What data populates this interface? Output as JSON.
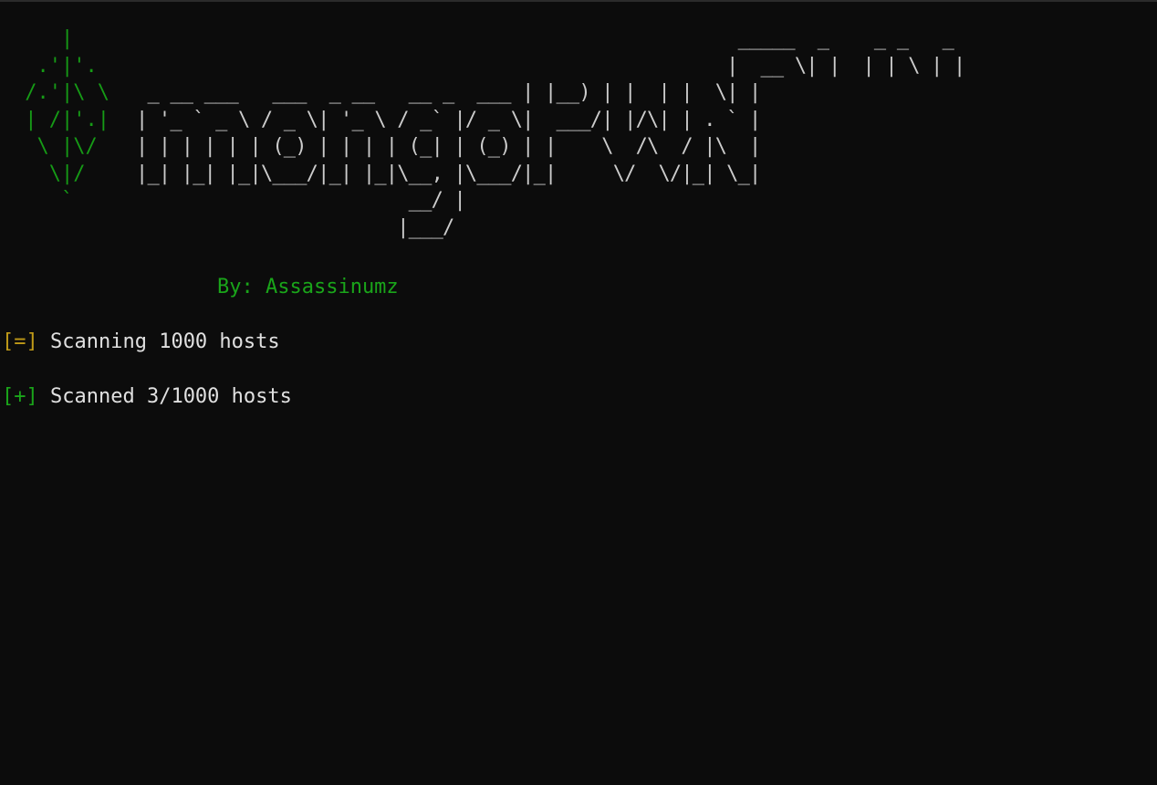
{
  "terminal": {
    "leaf_art": "    |\n  .'|'.\n /.'|\\ \\\n | /|'.|\n  \\ |\\/\n   \\|/\n    `",
    "logo_art": "                                                     _____  _    _ _   _\n                                                    |  __ \\| |  | | \\ | |\n _ __ ___   ___  _ __   __ _  ___ | |__) | |  | |  \\| |\n| '_ ` _ \\ / _ \\| '_ \\ / _` |/ _ \\|  ___/| |/\\| | . ` |\n| | | | | | (_) | | | | (_| | (_) | |    \\  /\\  / |\\  |\n|_| |_| |_|\\___/|_| |_|\\__, |\\___/|_|     \\/  \\/|_| \\_|\n                        __/ |\n                       |___/",
    "byline": "By: Assassinumz",
    "lines": [
      {
        "tag": "[=]",
        "text": " Scanning 1000 hosts"
      },
      {
        "tag": "[+]",
        "text": " Scanned 3/1000 hosts"
      }
    ]
  },
  "colors": {
    "background": "#0c0c0c",
    "foreground": "#cccccc",
    "green": "#1aa51a",
    "yellow": "#c09a18"
  }
}
